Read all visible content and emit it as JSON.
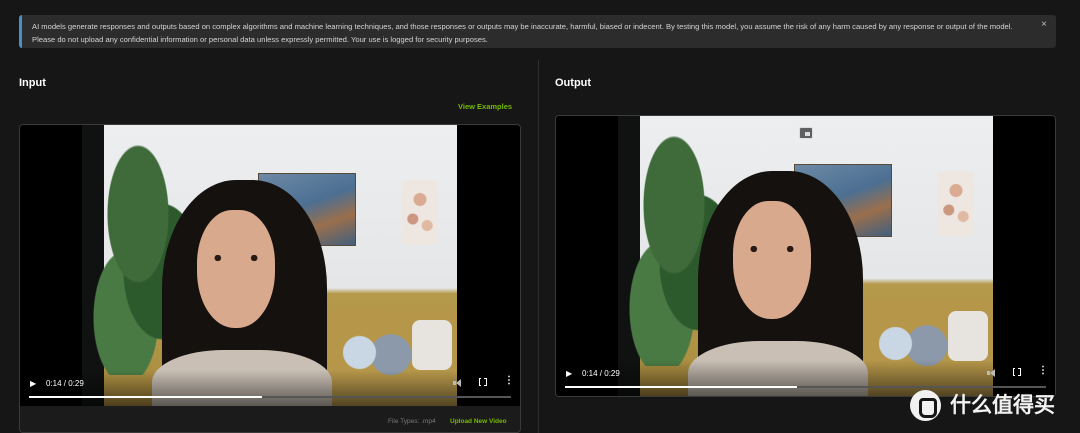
{
  "banner": {
    "text": "AI models generate responses and outputs based on complex algorithms and machine learning techniques, and those responses or outputs may be inaccurate, harmful, biased or indecent. By testing this model, you assume the risk of any harm caused by any response or output of the model. Please do not upload any confidential information or personal data unless expressly permitted. Your use is logged for security purposes.",
    "close_glyph": "×"
  },
  "input": {
    "title": "Input",
    "view_examples_label": "View Examples",
    "player": {
      "play_glyph": "▶",
      "time": "0:14 / 0:29",
      "progress": 0.483,
      "more_glyph": "⋮"
    },
    "file_types": "File Types: .mp4",
    "upload_label": "Upload New Video"
  },
  "output": {
    "title": "Output",
    "player": {
      "play_glyph": "▶",
      "time": "0:14 / 0:29",
      "progress": 0.483,
      "more_glyph": "⋮"
    }
  },
  "watermark": {
    "text": "什么值得买"
  },
  "colors": {
    "accent": "#76b900",
    "banner_border": "#4a90c8",
    "background": "#161616"
  },
  "icons": [
    "close-icon",
    "play-icon",
    "volume-icon",
    "fullscreen-icon",
    "more-options-icon",
    "picture-in-picture-icon",
    "smzdm-logo"
  ]
}
